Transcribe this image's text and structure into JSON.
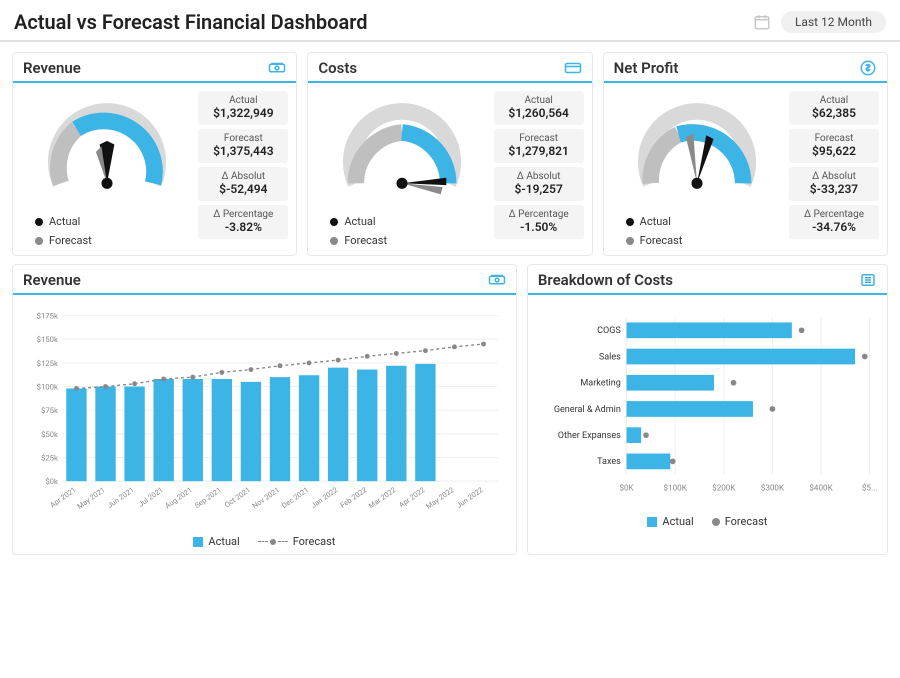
{
  "header": {
    "title": "Actual vs Forecast Financial Dashboard",
    "range_label": "Last 12 Month"
  },
  "cards": {
    "revenue": {
      "title": "Revenue",
      "actual_lbl": "Actual",
      "actual_val": "$1,322,949",
      "forecast_lbl": "Forecast",
      "forecast_val": "$1,375,443",
      "abs_lbl": "Δ Absolut",
      "abs_val": "$-52,494",
      "pct_lbl": "Δ Percentage",
      "pct_val": "-3.82%",
      "legend_actual": "Actual",
      "legend_forecast": "Forecast"
    },
    "costs": {
      "title": "Costs",
      "actual_lbl": "Actual",
      "actual_val": "$1,260,564",
      "forecast_lbl": "Forecast",
      "forecast_val": "$1,279,821",
      "abs_lbl": "Δ Absolut",
      "abs_val": "$-19,257",
      "pct_lbl": "Δ Percentage",
      "pct_val": "-1.50%",
      "legend_actual": "Actual",
      "legend_forecast": "Forecast"
    },
    "net": {
      "title": "Net Profit",
      "actual_lbl": "Actual",
      "actual_val": "$62,385",
      "forecast_lbl": "Forecast",
      "forecast_val": "$95,622",
      "abs_lbl": "Δ Absolut",
      "abs_val": "$-33,237",
      "pct_lbl": "Δ Percentage",
      "pct_val": "-34.76%",
      "legend_actual": "Actual",
      "legend_forecast": "Forecast"
    }
  },
  "revenue_chart_title": "Revenue",
  "cost_chart_title": "Breakdown of Costs",
  "legend": {
    "actual": "Actual",
    "forecast": "Forecast"
  },
  "chart_data": [
    {
      "id": "revenue_monthly",
      "type": "bar",
      "title": "Revenue",
      "categories": [
        "Apr 2021",
        "May 2021",
        "Jun 2021",
        "Jul 2021",
        "Aug 2021",
        "Sep 2021",
        "Oct 2021",
        "Nov 2021",
        "Dec 2021",
        "Jan 2022",
        "Feb 2022",
        "Mar 2022",
        "Apr 2022",
        "May 2022",
        "Jun 2022"
      ],
      "series": [
        {
          "name": "Actual",
          "values": [
            98,
            100,
            100,
            108,
            108,
            108,
            105,
            110,
            112,
            120,
            118,
            122,
            124,
            null,
            null
          ]
        },
        {
          "name": "Forecast",
          "values": [
            98,
            100,
            103,
            108,
            110,
            115,
            118,
            122,
            125,
            128,
            132,
            135,
            138,
            142,
            145
          ],
          "style": "line-dashed"
        }
      ],
      "ylabel": "",
      "xlabel": "",
      "y_ticks": [
        "$0k",
        "$25k",
        "$50k",
        "$75k",
        "$100k",
        "$125k",
        "$150k",
        "$175k"
      ],
      "ylim": [
        0,
        175
      ]
    },
    {
      "id": "cost_breakdown",
      "type": "bar-horizontal",
      "title": "Breakdown of Costs",
      "categories": [
        "COGS",
        "Sales",
        "Marketing",
        "General & Admin",
        "Other Expanses",
        "Taxes"
      ],
      "series": [
        {
          "name": "Actual",
          "values": [
            340,
            470,
            180,
            260,
            30,
            90
          ]
        },
        {
          "name": "Forecast",
          "values": [
            360,
            490,
            220,
            300,
            40,
            95
          ],
          "style": "point"
        }
      ],
      "x_ticks": [
        "$0K",
        "$100K",
        "$200K",
        "$300K",
        "$400K",
        "$5..."
      ],
      "xlim": [
        0,
        500
      ]
    },
    {
      "id": "gauge_revenue",
      "type": "gauge",
      "actual": 1322949,
      "forecast": 1375443,
      "delta_abs": -52494,
      "delta_pct": -3.82
    },
    {
      "id": "gauge_costs",
      "type": "gauge",
      "actual": 1260564,
      "forecast": 1279821,
      "delta_abs": -19257,
      "delta_pct": -1.5
    },
    {
      "id": "gauge_net_profit",
      "type": "gauge",
      "actual": 62385,
      "forecast": 95622,
      "delta_abs": -33237,
      "delta_pct": -34.76
    }
  ]
}
